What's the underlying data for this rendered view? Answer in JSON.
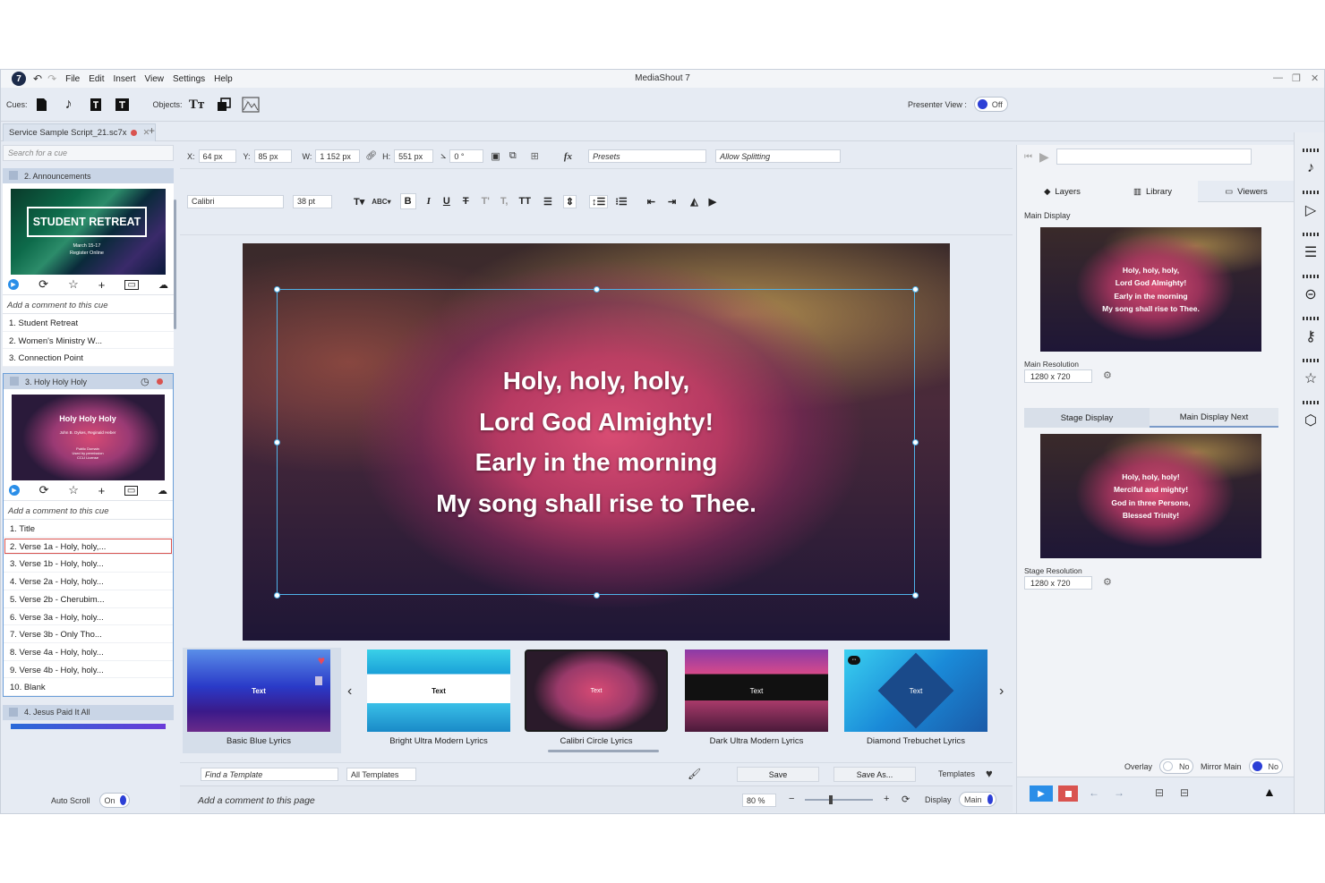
{
  "app": {
    "title": "MediaShout 7",
    "menu": [
      "File",
      "Edit",
      "Insert",
      "View",
      "Settings",
      "Help"
    ]
  },
  "toolbar": {
    "cues_label": "Cues:",
    "objects_label": "Objects:",
    "presenter_view_label": "Presenter View :",
    "presenter_view_value": "Off"
  },
  "doc_tab": {
    "name": "Service Sample Script_21.sc7x"
  },
  "left": {
    "search_placeholder": "Search for a cue",
    "cue2": {
      "header": "2.  Announcements",
      "thumb_title": "STUDENT RETREAT",
      "thumb_line1": "March 15-17",
      "thumb_line2": "Register Online",
      "comment": "Add a comment to this cue",
      "items": [
        "1.  Student Retreat",
        "2.  Women's Ministry W...",
        "3.  Connection Point"
      ]
    },
    "cue3": {
      "header": "3.  Holy Holy Holy",
      "thumb_title": "Holy Holy Holy",
      "thumb_sub": "John B. Dykes, Reginald Heber",
      "thumb_small": "Public Domain\nUsed by permission\nCCLI License",
      "comment": "Add a comment to this cue",
      "items": [
        "1.  Title",
        "2.  Verse 1a - Holy, holy,...",
        "3.  Verse 1b - Holy, holy...",
        "4.  Verse 2a - Holy, holy...",
        "5.  Verse 2b - Cherubim...",
        "6.  Verse 3a - Holy, holy...",
        "7.  Verse 3b - Only Tho...",
        "8.  Verse 4a - Holy, holy...",
        "9.  Verse 4b - Holy, holy...",
        "10.  Blank"
      ],
      "selected_index": 1
    },
    "cue4": {
      "header": "4.  Jesus Paid It All"
    },
    "auto_scroll_label": "Auto Scroll",
    "auto_scroll_value": "On"
  },
  "props": {
    "x_label": "X:",
    "x_value": "64 px",
    "y_label": "Y:",
    "y_value": "85 px",
    "w_label": "W:",
    "w_value": "1 152 px",
    "h_label": "H:",
    "h_value": "551 px",
    "rotation_value": "0 °",
    "presets": "Presets",
    "splitting": "Allow Splitting",
    "font": "Calibri",
    "font_size": "38 pt",
    "fx": "fx"
  },
  "slide": {
    "lines": [
      "Holy, holy, holy,",
      "Lord God Almighty!",
      "Early in the morning",
      "My song shall rise to Thee."
    ]
  },
  "templates": {
    "items": [
      {
        "name": "Basic Blue Lyrics",
        "text": "Text"
      },
      {
        "name": "Bright Ultra Modern Lyrics",
        "text": "Text"
      },
      {
        "name": "Calibri Circle Lyrics",
        "text": "Text"
      },
      {
        "name": "Dark Ultra Modern Lyrics",
        "text": "Text"
      },
      {
        "name": "Diamond Trebuchet Lyrics",
        "text": "Text"
      }
    ],
    "find_placeholder": "Find a Template",
    "filter": "All Templates",
    "save": "Save",
    "save_as": "Save As...",
    "templates_label": "Templates"
  },
  "status": {
    "comment": "Add a comment to this page",
    "zoom": "80 %",
    "minus": "−",
    "plus": "+",
    "display_label": "Display",
    "display_value": "Main"
  },
  "right": {
    "tabs": [
      "Layers",
      "Library",
      "Viewers"
    ],
    "main_display_label": "Main Display",
    "main_lines": [
      "Holy, holy, holy,",
      "Lord God Almighty!",
      "Early in the morning",
      "My song shall rise to Thee."
    ],
    "main_resolution_label": "Main Resolution",
    "main_resolution": "1280 x 720",
    "sub_tabs": [
      "Stage Display",
      "Main Display Next"
    ],
    "next_lines": [
      "Holy, holy, holy!",
      "Merciful and mighty!",
      "God in three Persons,",
      "Blessed Trinity!"
    ],
    "stage_resolution_label": "Stage Resolution",
    "stage_resolution": "1280 x 720",
    "overlay_label": "Overlay",
    "overlay_value": "No",
    "mirror_label": "Mirror Main",
    "mirror_value": "No"
  },
  "colors": {
    "accent": "#2c3fd6",
    "selection": "#4fb2e8",
    "live_red": "#d9534f"
  }
}
